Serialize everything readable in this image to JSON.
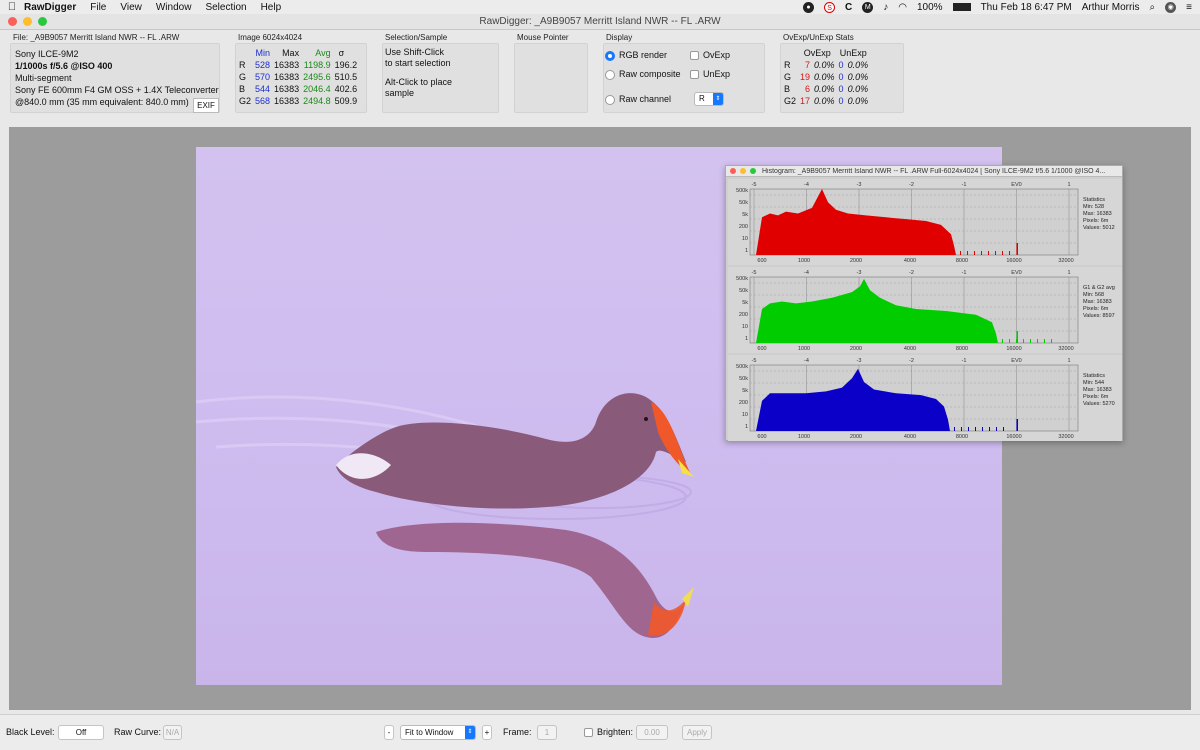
{
  "menubar": {
    "app": "RawDigger",
    "items": [
      "File",
      "View",
      "Window",
      "Selection",
      "Help"
    ],
    "status_icons": [
      "s-icon",
      "c-icon",
      "m-icon"
    ],
    "battery": "100%",
    "datetime": "Thu Feb 18  6:47 PM",
    "user": "Arthur Morris"
  },
  "window": {
    "title": "RawDigger: _A9B9057  Merritt Island NWR -- FL .ARW"
  },
  "file_panel": {
    "label": "File: _A9B9057  Merritt Island NWR -- FL .ARW",
    "camera": "Sony ILCE-9M2",
    "exposure": "1/1000s f/5.6 @ISO 400",
    "metering": "Multi-segment",
    "lens": "Sony FE 600mm F4 GM OSS + 1.4X Teleconverter",
    "focal": "@840.0 mm (35 mm equivalent: 840.0 mm)",
    "exif_button": "EXIF"
  },
  "image_panel": {
    "label": "Image 6024x4024",
    "headers": [
      "Min",
      "Max",
      "Avg",
      "σ"
    ],
    "rows": [
      {
        "ch": "R",
        "min": "528",
        "max": "16383",
        "avg": "1198.9",
        "sd": "196.2"
      },
      {
        "ch": "G",
        "min": "570",
        "max": "16383",
        "avg": "2495.6",
        "sd": "510.5"
      },
      {
        "ch": "B",
        "min": "544",
        "max": "16383",
        "avg": "2046.4",
        "sd": "402.6"
      },
      {
        "ch": "G2",
        "min": "568",
        "max": "16383",
        "avg": "2494.8",
        "sd": "509.9"
      }
    ]
  },
  "selection_panel": {
    "label": "Selection/Sample",
    "line1": "Use Shift-Click",
    "line2": "to start selection",
    "line3": "Alt-Click to place",
    "line4": "sample"
  },
  "mouse_panel": {
    "label": "Mouse Pointer"
  },
  "display_panel": {
    "label": "Display",
    "rgb_render": "RGB render",
    "raw_composite": "Raw composite",
    "raw_channel": "Raw channel",
    "ovexp": "OvExp",
    "unexp": "UnExp",
    "channel_value": "R"
  },
  "ovexp_panel": {
    "label": "OvExp/UnExp Stats",
    "headers": [
      "OvExp",
      "UnExp"
    ],
    "rows": [
      {
        "ch": "R",
        "ov_n": "7",
        "ov_p": "0.0%",
        "un_n": "0",
        "un_p": "0.0%"
      },
      {
        "ch": "G",
        "ov_n": "19",
        "ov_p": "0.0%",
        "un_n": "0",
        "un_p": "0.0%"
      },
      {
        "ch": "B",
        "ov_n": "6",
        "ov_p": "0.0%",
        "un_n": "0",
        "un_p": "0.0%"
      },
      {
        "ch": "G2",
        "ov_n": "17",
        "ov_p": "0.0%",
        "un_n": "0",
        "un_p": "0.0%"
      }
    ]
  },
  "histogram": {
    "title": "Histogram: _A9B9057  Merritt Island NWR -- FL .ARW Full-6024x4024 [ Sony ILCE-9M2 f/5.6 1/1000 @ISO 4...",
    "ev_labels": [
      "-5",
      "-4",
      "-3",
      "-2",
      "-1",
      "EV0",
      "1"
    ],
    "x_labels": [
      "600",
      "1000",
      "2000",
      "4000",
      "8000",
      "16000",
      "32000"
    ],
    "y_labels": [
      "500k",
      "50k",
      "5k",
      "200",
      "10",
      "1"
    ],
    "panes": [
      {
        "color": "#e00000",
        "lines": [
          "Statistics",
          "Min: 528",
          "Max: 16383",
          "Pixels: 6m",
          "Values: 5012"
        ]
      },
      {
        "color": "#00cc00",
        "lines": [
          "G1 & G2 avg",
          "Min: 568",
          "Max: 16383",
          "Pixels: 6m",
          "Values: 8597"
        ]
      },
      {
        "color": "#0a00c8",
        "lines": [
          "Statistics",
          "Min: 544",
          "Max: 16383",
          "Pixels: 6m",
          "Values: 5270"
        ]
      }
    ]
  },
  "toolbar": {
    "black_level_label": "Black Level:",
    "black_level_value": "Off",
    "raw_curve_label": "Raw Curve:",
    "raw_curve_value": "N/A",
    "minus": "-",
    "fit_value": "Fit to Window",
    "plus": "+",
    "frame_label": "Frame:",
    "frame_value": "1",
    "brighten_label": "Brighten:",
    "brighten_value": "0.00",
    "apply": "Apply"
  },
  "colors": {
    "accent": "#1677ff",
    "photo_bg": "#d0bff0"
  }
}
